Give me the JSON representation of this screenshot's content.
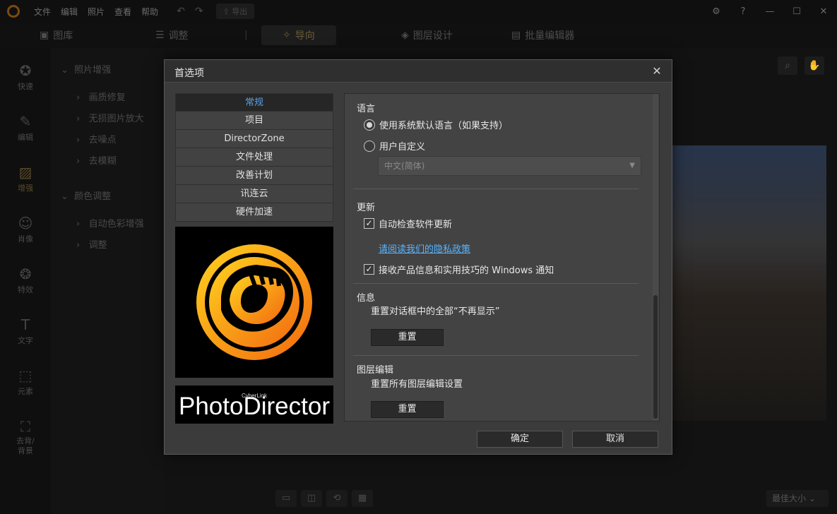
{
  "menubar": {
    "items": [
      "文件",
      "编辑",
      "照片",
      "查看",
      "帮助"
    ],
    "export_label": "导出"
  },
  "modetabs": {
    "library": "图库",
    "adjust": "调整",
    "guided": "导向",
    "layers": "图层设计",
    "batch": "批量编辑器"
  },
  "sidetools": [
    "快速",
    "编辑",
    "增强",
    "肖像",
    "特效",
    "文字",
    "元素",
    "去背/背景"
  ],
  "leftpanel": {
    "group1": "照片增强",
    "items1": [
      "画质修复",
      "无损图片放大",
      "去噪点",
      "去模糊"
    ],
    "group2": "颜色调整",
    "items2": [
      "自动色彩增强",
      "调整"
    ]
  },
  "fit_select": "最佳大小",
  "dialog": {
    "title": "首选项",
    "nav": [
      "常规",
      "项目",
      "DirectorZone",
      "文件处理",
      "改善计划",
      "讯连云",
      "硬件加速"
    ],
    "brand_small": "CyberLink",
    "brand_big": "PhotoDirector",
    "language": {
      "heading": "语言",
      "opt_default": "使用系统默认语言（如果支持）",
      "opt_custom": "用户自定义",
      "select_value": "中文(简体)"
    },
    "update": {
      "heading": "更新",
      "auto_check": "自动检查软件更新",
      "privacy_link": "请阅读我们的隐私政策",
      "receive_tips": "接收产品信息和实用技巧的 Windows 通知"
    },
    "info": {
      "heading": "信息",
      "desc": "重置对话框中的全部“不再显示”",
      "reset": "重置"
    },
    "layer_edit": {
      "heading": "图层编辑",
      "desc": "重置所有图层编辑设置",
      "reset": "重置"
    },
    "ok": "确定",
    "cancel": "取消"
  },
  "colors": {
    "accent_blue": "#5aa0e6",
    "link": "#58b4ff",
    "logo_orange": "#f7a21b"
  }
}
